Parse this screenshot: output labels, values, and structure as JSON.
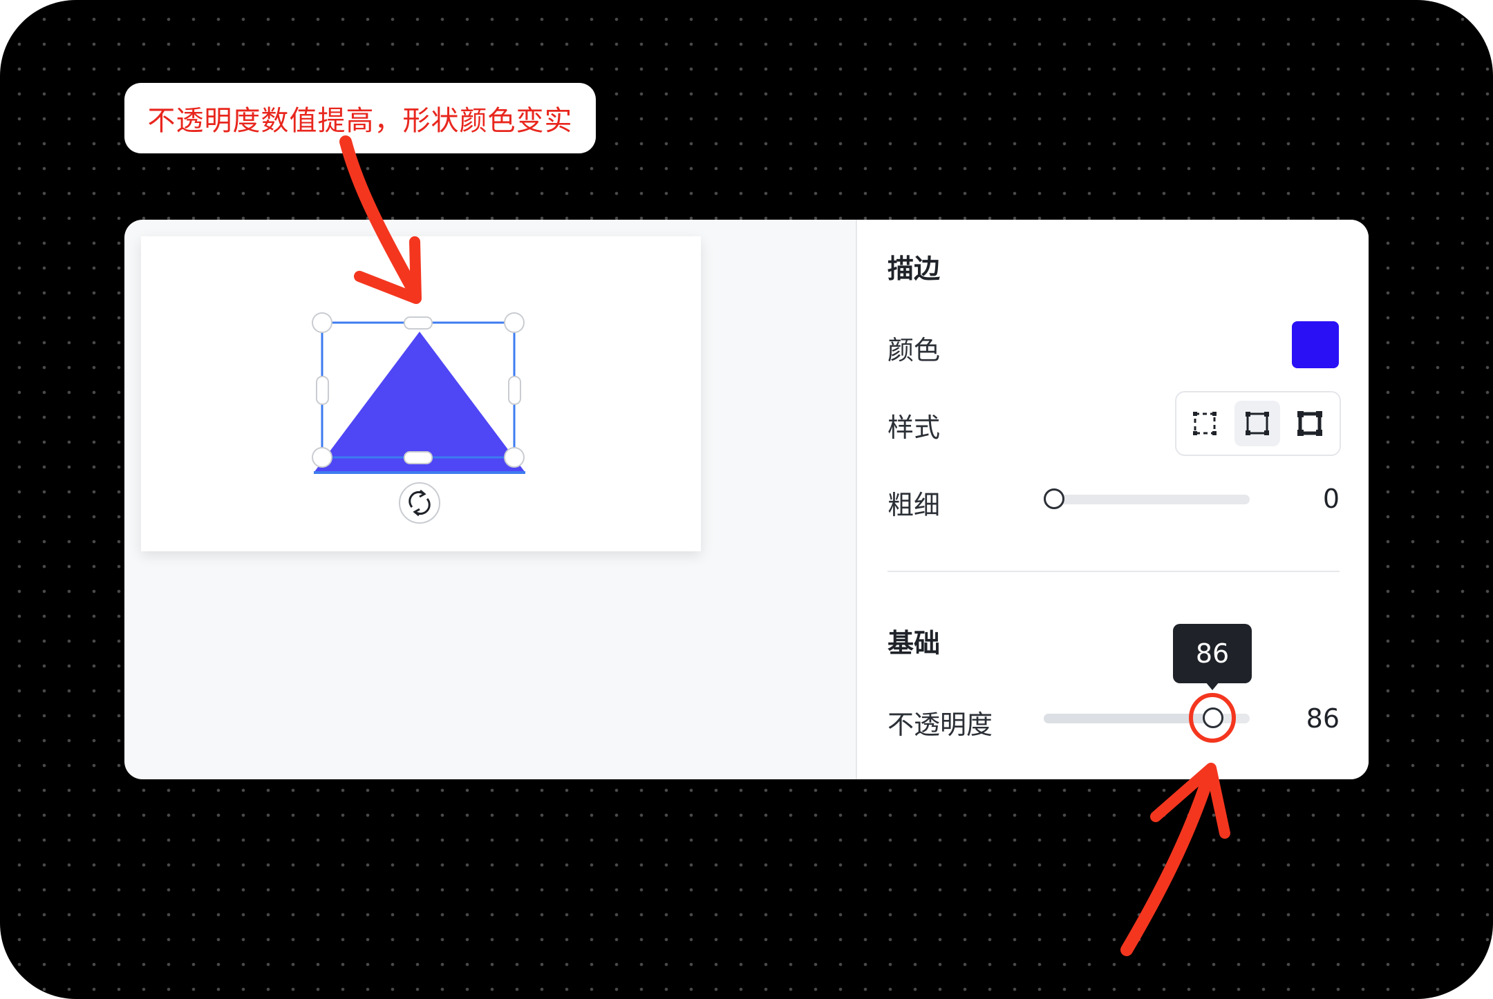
{
  "annotation": {
    "callout_text": "不透明度数值提高，形状颜色变实",
    "arrow_color": "#f4361f"
  },
  "canvas": {
    "shape": "triangle",
    "shape_color": "#4f46f5",
    "selection_color": "#3d7bf0",
    "rotate_icon": "rotate-icon"
  },
  "stroke_section": {
    "title": "描边",
    "color_label": "颜色",
    "color_value": "#2a10f5",
    "style_label": "样式",
    "style_options": [
      "dashed-corners-icon",
      "corner-handles-icon",
      "solid-frame-icon"
    ],
    "style_selected_index": 1,
    "weight_label": "粗细",
    "weight_value": "0"
  },
  "basic_section": {
    "title": "基础",
    "opacity_label": "不透明度",
    "opacity_value": "86",
    "opacity_tooltip": "86",
    "opacity_level": 0.86
  }
}
